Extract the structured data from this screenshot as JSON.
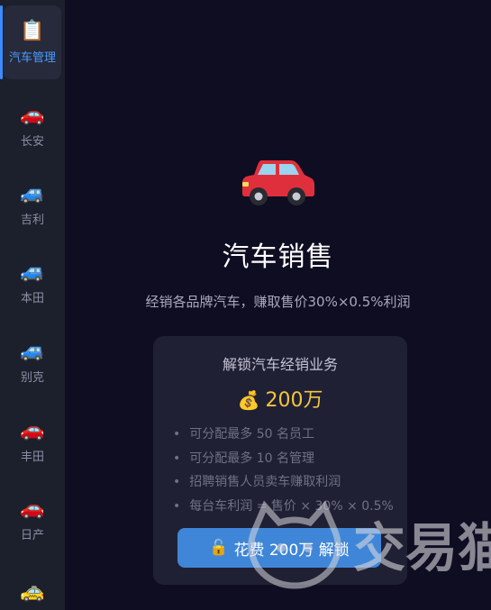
{
  "sidebar": {
    "items": [
      {
        "label": "汽车管理",
        "icon": "📋",
        "icon_name": "clipboard-icon",
        "active": true
      },
      {
        "label": "长安",
        "icon": "🚗",
        "icon_name": "red-car-icon"
      },
      {
        "label": "吉利",
        "icon": "🚙",
        "icon_name": "blue-car-icon"
      },
      {
        "label": "本田",
        "icon": "🚙",
        "icon_name": "blue-car-icon"
      },
      {
        "label": "别克",
        "icon": "🚙",
        "icon_name": "blue-car-icon"
      },
      {
        "label": "丰田",
        "icon": "🚗",
        "icon_name": "red-car-icon"
      },
      {
        "label": "日产",
        "icon": "🚗",
        "icon_name": "red-car-icon"
      },
      {
        "label": "",
        "icon": "🚕",
        "icon_name": "taxi-icon"
      }
    ],
    "accent": "#3c8cff"
  },
  "main": {
    "title": "汽车销售",
    "subtitle": "经销各品牌汽车，赚取售价30%×0.5%利润",
    "card": {
      "title": "解锁汽车经销业务",
      "price_icon": "💰",
      "price": "200万",
      "features": [
        "可分配最多 50 名员工",
        "可分配最多 10 名管理",
        "招聘销售人员卖车赚取利润",
        "每台车利润 = 售价 × 30% × 0.5%"
      ],
      "button_icon": "🔓",
      "button_label": "花费 200万 解锁"
    }
  },
  "watermark": {
    "text": "交易猫"
  },
  "colors": {
    "background": "#0f0d22",
    "card": "#1f2034",
    "button": "#3f86d8",
    "price": "#f5c440"
  }
}
